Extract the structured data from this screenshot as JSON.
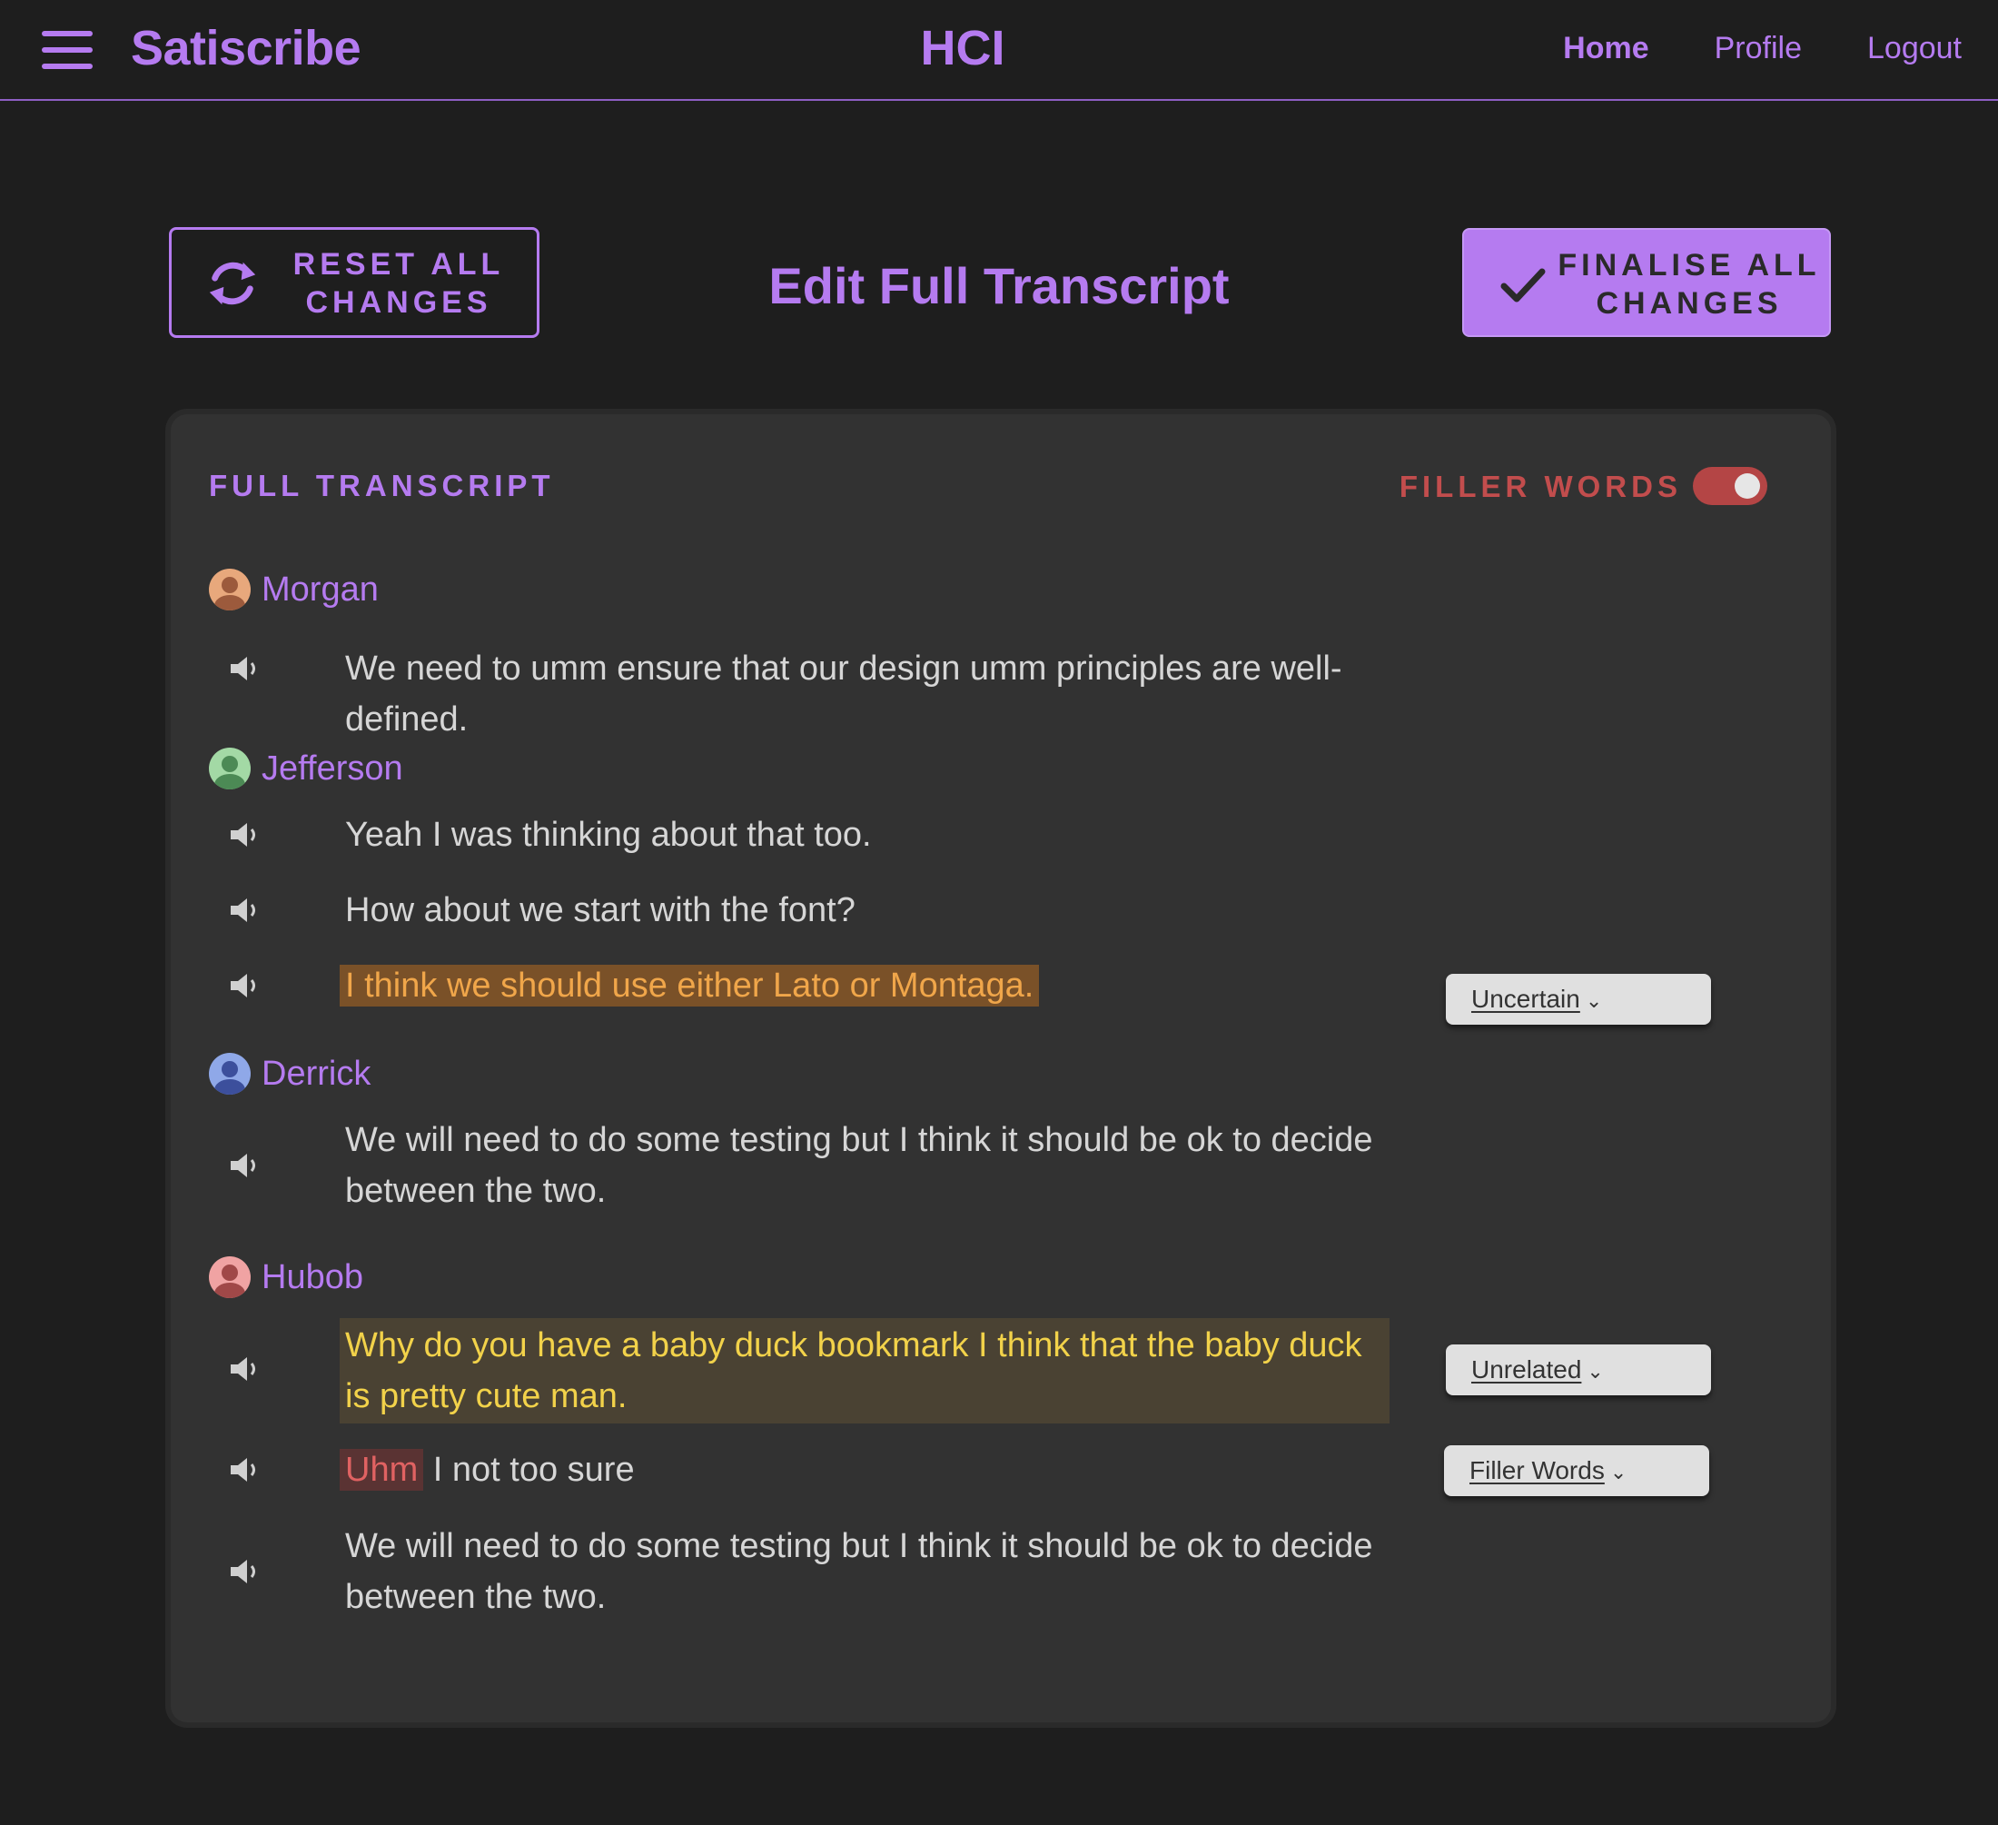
{
  "nav": {
    "brand": "Satiscribe",
    "center_title": "HCI",
    "links": [
      "Home",
      "Profile",
      "Logout"
    ]
  },
  "actions": {
    "reset_label": "RESET ALL CHANGES",
    "page_heading": "Edit Full Transcript",
    "finalise_label": "FINALISE ALL CHANGES"
  },
  "transcript": {
    "title": "FULL TRANSCRIPT",
    "filler_toggle_label": "FILLER WORDS",
    "filler_toggle_on": true,
    "speakers": [
      {
        "name": "Morgan",
        "avatar_color": "#e8a87c",
        "figure_color": "#9c5a3c"
      },
      {
        "name": "Jefferson",
        "avatar_color": "#a3d9a5",
        "figure_color": "#4c8a55"
      },
      {
        "name": "Derrick",
        "avatar_color": "#8fa8e8",
        "figure_color": "#3c4f9c"
      },
      {
        "name": "Hubob",
        "avatar_color": "#f0a3a3",
        "figure_color": "#a04848"
      }
    ],
    "lines": [
      {
        "text": "We need to umm ensure that our design umm principles are well-defined."
      },
      {
        "text": "Yeah I was thinking about that too."
      },
      {
        "text": "How about we start with the font?"
      },
      {
        "text": "I think we should use either Lato or Montaga.",
        "tag": "Uncertain"
      },
      {
        "text": "We will need to do some testing but I think it should be ok to decide between the two."
      },
      {
        "text": "Why do you have a baby duck bookmark I think that the baby duck is pretty cute man.",
        "tag": "Unrelated"
      },
      {
        "filler": "Uhm",
        "text": " I not too sure",
        "tag": "Filler Words"
      },
      {
        "text": "We will need to do some testing but I think it should be ok to decide between the two."
      }
    ]
  },
  "colors": {
    "accent": "#b57bf0",
    "background": "#1e1e1e",
    "card": "#323232",
    "uncertain": "#f0a64a",
    "unrelated": "#f2d24a",
    "filler": "#e06262"
  }
}
